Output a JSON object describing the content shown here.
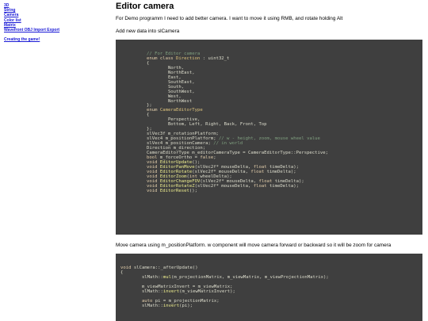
{
  "sidebar": {
    "links": [
      "3D",
      "String",
      "Camera",
      "Color list",
      "Matrix",
      "Wavefront OBJ Import Export"
    ],
    "extra_link": "Creating the game!"
  },
  "article": {
    "title": "Editor camera",
    "intro": "For Demo programm I need to add better camera. I want to move it using RMB, and rotate holding Alt",
    "add_note": "Add new data into slCamera",
    "move_note": "Move camera using m_positionPlatform. w component will move camera forward or backward so it will be zoom for camera"
  },
  "code1": [
    [
      [
        "c",
        "// For Editor camera"
      ]
    ],
    [
      [
        "k",
        "enum class "
      ],
      [
        "t",
        "Direction "
      ],
      [
        "p",
        ": uint32_t"
      ]
    ],
    [
      [
        "p",
        "{"
      ]
    ],
    [
      [
        "p",
        "        North,"
      ]
    ],
    [
      [
        "p",
        "        NorthEast,"
      ]
    ],
    [
      [
        "p",
        "        East,"
      ]
    ],
    [
      [
        "p",
        "        SouthEast,"
      ]
    ],
    [
      [
        "p",
        "        South,"
      ]
    ],
    [
      [
        "p",
        "        SouthWest,"
      ]
    ],
    [
      [
        "p",
        "        West,"
      ]
    ],
    [
      [
        "p",
        "        NorthWest"
      ]
    ],
    [
      [
        "p",
        "};"
      ]
    ],
    [
      [
        "k",
        "enum "
      ],
      [
        "t",
        "CameraEditorType"
      ]
    ],
    [
      [
        "p",
        "{"
      ]
    ],
    [
      [
        "p",
        "        Perspective,"
      ]
    ],
    [
      [
        "p",
        "        Bottom, Left, Right, Back, Front, Top"
      ]
    ],
    [
      [
        "p",
        "};"
      ]
    ],
    [
      [
        "p",
        "slVec3f m_rotationPlatform;"
      ]
    ],
    [
      [
        "p",
        "slVec4 m_positionPlatform; "
      ],
      [
        "c",
        "// w - height, zoom, mouse wheel value"
      ]
    ],
    [
      [
        "p",
        "slVec4 m_positionCamera; "
      ],
      [
        "c",
        "// in world"
      ]
    ],
    [
      [
        "p",
        "Direction m_direction;"
      ]
    ],
    [
      [
        "p",
        "CameraEditorType m_editorCameraType = CameraEditorType::Perspective;"
      ]
    ],
    [
      [
        "k",
        "bool "
      ],
      [
        "p",
        "m_forceOrtho = "
      ],
      [
        "k",
        "false"
      ],
      [
        "p",
        ";"
      ]
    ],
    [
      [
        "k",
        "void "
      ],
      [
        "f",
        "EditorUpdate"
      ],
      [
        "p",
        "();"
      ]
    ],
    [
      [
        "k",
        "void "
      ],
      [
        "f",
        "EditorPanMove"
      ],
      [
        "p",
        "(slVec2f* mouseDelta, "
      ],
      [
        "k",
        "float "
      ],
      [
        "p",
        "timeDelta);"
      ]
    ],
    [
      [
        "k",
        "void "
      ],
      [
        "f",
        "EditorRotate"
      ],
      [
        "p",
        "(slVec2f* mouseDelta, "
      ],
      [
        "k",
        "float "
      ],
      [
        "p",
        "timeDelta);"
      ]
    ],
    [
      [
        "k",
        "void "
      ],
      [
        "f",
        "EditorZoom"
      ],
      [
        "p",
        "("
      ],
      [
        "k",
        "int "
      ],
      [
        "p",
        "wheelDelta);"
      ]
    ],
    [
      [
        "k",
        "void "
      ],
      [
        "f",
        "EditorChangeFOV"
      ],
      [
        "p",
        "(slVec2f* mouseDelta, "
      ],
      [
        "k",
        "float "
      ],
      [
        "p",
        "timeDelta);"
      ]
    ],
    [
      [
        "k",
        "void "
      ],
      [
        "f",
        "EditorRotateZ"
      ],
      [
        "p",
        "(slVec2f* mouseDelta, "
      ],
      [
        "k",
        "float "
      ],
      [
        "p",
        "timeDelta);"
      ]
    ],
    [
      [
        "k",
        "void "
      ],
      [
        "f",
        "EditorReset"
      ],
      [
        "p",
        "();"
      ]
    ]
  ],
  "code2": [
    [
      [
        "k",
        "void "
      ],
      [
        "p",
        "slCamera::_afterUpdate()"
      ]
    ],
    [
      [
        "p",
        "{"
      ]
    ],
    [
      [
        "p",
        "        slMath::"
      ],
      [
        "f",
        "mul"
      ],
      [
        "p",
        "(m_projectionMatrix, m_viewMatrix, m_viewProjectionMatrix);"
      ]
    ],
    [
      [
        "p",
        ""
      ]
    ],
    [
      [
        "p",
        "        m_viewMatrixInvert = m_viewMatrix;"
      ]
    ],
    [
      [
        "p",
        "        slMath::"
      ],
      [
        "f",
        "invert"
      ],
      [
        "p",
        "(m_viewMatrixInvert);"
      ]
    ],
    [
      [
        "p",
        ""
      ]
    ],
    [
      [
        "k",
        "        auto "
      ],
      [
        "p",
        "pi = m_projectionMatrix;"
      ]
    ],
    [
      [
        "p",
        "        slMath::"
      ],
      [
        "f",
        "invert"
      ],
      [
        "p",
        "(pi);"
      ]
    ]
  ]
}
